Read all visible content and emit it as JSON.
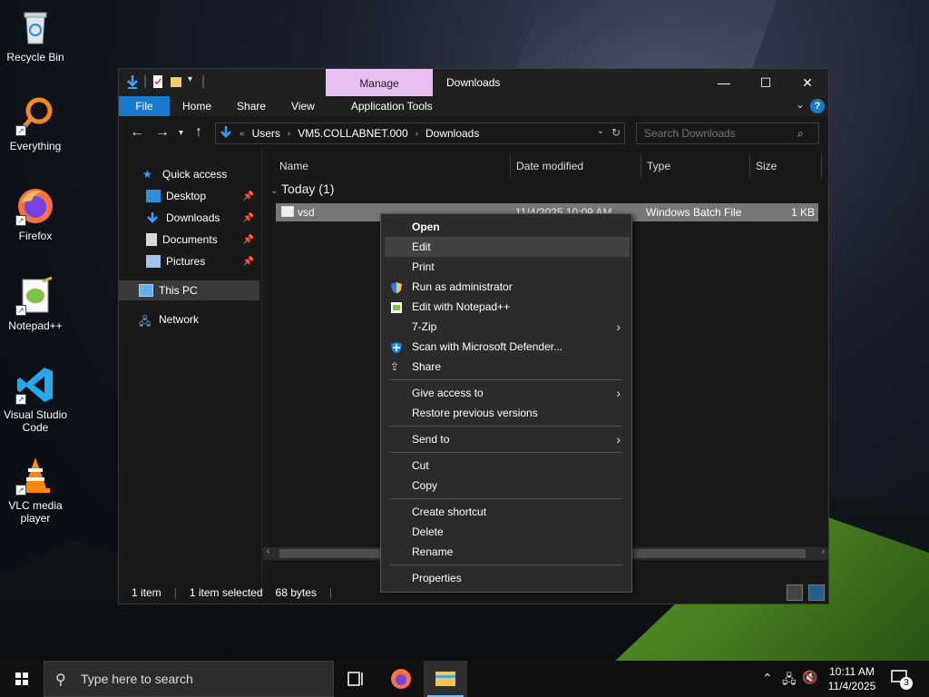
{
  "desktop": {
    "icons": [
      {
        "label": "Recycle Bin"
      },
      {
        "label": "Everything"
      },
      {
        "label": "Firefox"
      },
      {
        "label": "Notepad++"
      },
      {
        "label": "Visual Studio Code"
      },
      {
        "label": "VLC media player"
      }
    ]
  },
  "window": {
    "manage_tab": "Manage",
    "title": "Downloads",
    "ribbon_tabs": [
      "File",
      "Home",
      "Share",
      "View",
      "Application Tools"
    ],
    "address": {
      "segments": [
        "Users",
        "VM5.COLLABNET.000",
        "Downloads"
      ]
    },
    "search_placeholder": "Search Downloads",
    "nav": {
      "quick_access": "Quick access",
      "desktop": "Desktop",
      "downloads": "Downloads",
      "documents": "Documents",
      "pictures": "Pictures",
      "this_pc": "This PC",
      "network": "Network"
    },
    "columns": {
      "name": "Name",
      "date_modified": "Date modified",
      "type": "Type",
      "size": "Size"
    },
    "group_header": "Today (1)",
    "file": {
      "name": "vsd",
      "date": "11/4/2025 10:09 AM",
      "type": "Windows Batch File",
      "size": "1 KB"
    },
    "status": {
      "count": "1 item",
      "selected": "1 item selected",
      "size": "68 bytes"
    }
  },
  "context_menu": {
    "open": "Open",
    "edit": "Edit",
    "print": "Print",
    "run_as_admin": "Run as administrator",
    "edit_notepadpp": "Edit with Notepad++",
    "sevenzip": "7-Zip",
    "scan_defender": "Scan with Microsoft Defender...",
    "share": "Share",
    "give_access": "Give access to",
    "restore_versions": "Restore previous versions",
    "send_to": "Send to",
    "cut": "Cut",
    "copy": "Copy",
    "create_shortcut": "Create shortcut",
    "delete": "Delete",
    "rename": "Rename",
    "properties": "Properties"
  },
  "taskbar": {
    "search_placeholder": "Type here to search",
    "time": "10:11 AM",
    "date": "11/4/2025",
    "notifications": "3"
  },
  "colors": {
    "accent": "#1979ca",
    "manage_tab": "#e8c0f0",
    "selection": "#777777",
    "menu_bg": "#2b2b2b"
  }
}
